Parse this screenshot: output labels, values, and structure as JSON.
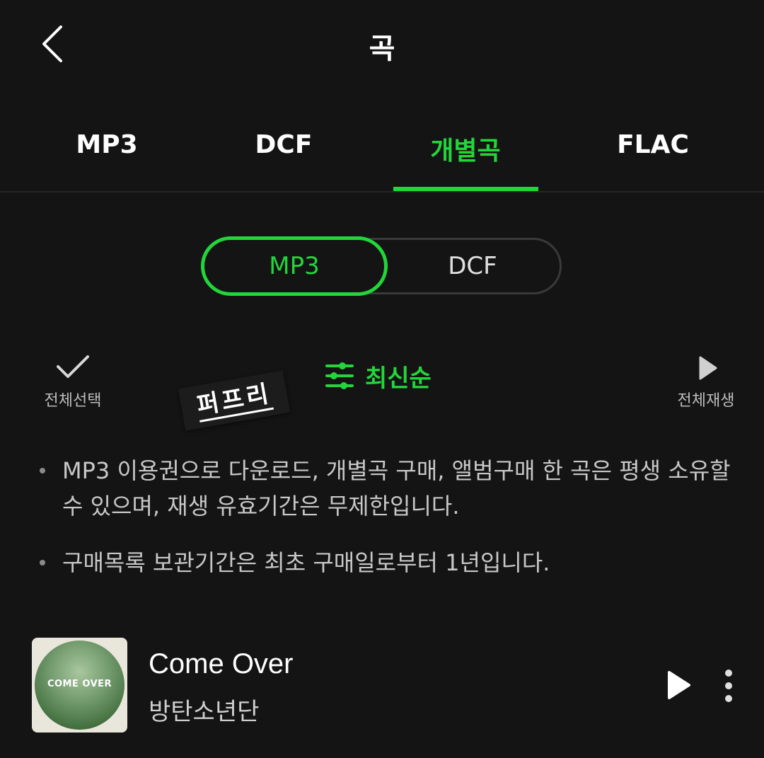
{
  "header": {
    "title": "곡",
    "back_icon": "chevron-left-icon"
  },
  "tabs": [
    {
      "label": "MP3",
      "active": false
    },
    {
      "label": "DCF",
      "active": false
    },
    {
      "label": "개별곡",
      "active": true
    },
    {
      "label": "FLAC",
      "active": false
    }
  ],
  "segment": {
    "options": [
      "MP3",
      "DCF"
    ],
    "selected": "MP3"
  },
  "controls": {
    "select_all_label": "전체선택",
    "sort_label": "최신순",
    "play_all_label": "전체재생"
  },
  "sticker": {
    "text": "퍼프리"
  },
  "notices": [
    "MP3 이용권으로 다운로드, 개별곡 구매, 앨범구매 한 곡은 평생 소유할 수 있으며, 재생 유효기간은 무제한입니다.",
    "구매목록 보관기간은 최초 구매일로부터 1년입니다."
  ],
  "song": {
    "title": "Come Over",
    "artist": "방탄소년단",
    "cover_text": "COME OVER"
  },
  "colors": {
    "accent": "#22d63a",
    "background": "#141414"
  }
}
